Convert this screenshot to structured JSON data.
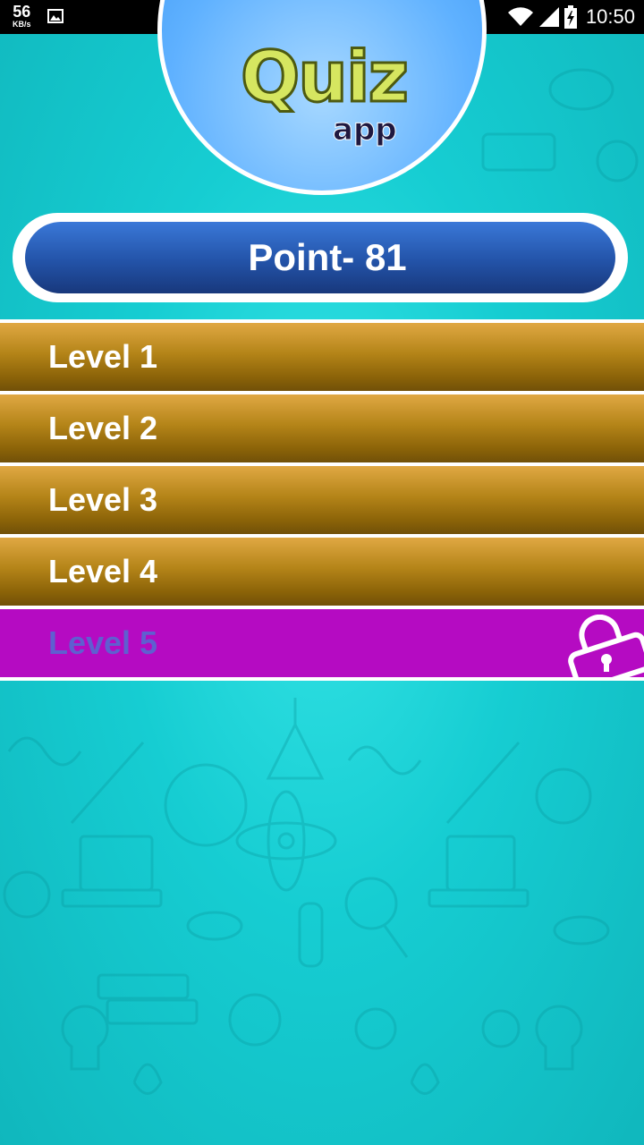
{
  "status_bar": {
    "speed_value": "56",
    "speed_unit": "KB/s",
    "time": "10:50",
    "icons": [
      "image-icon",
      "wifi-icon",
      "signal-icon",
      "battery-charging-icon"
    ]
  },
  "logo": {
    "word_main": "Quiz",
    "word_sub": "app"
  },
  "points": {
    "label": "Point- 81"
  },
  "levels": [
    {
      "label": "Level 1",
      "locked": false
    },
    {
      "label": "Level 2",
      "locked": false
    },
    {
      "label": "Level 3",
      "locked": false
    },
    {
      "label": "Level 4",
      "locked": false
    },
    {
      "label": "Level 5",
      "locked": true,
      "icon": "lock-icon"
    }
  ],
  "colors": {
    "background": "#16cdd2",
    "level_gold": "#b48418",
    "level_locked": "#b50bc2",
    "points_blue": "#2353a8"
  }
}
